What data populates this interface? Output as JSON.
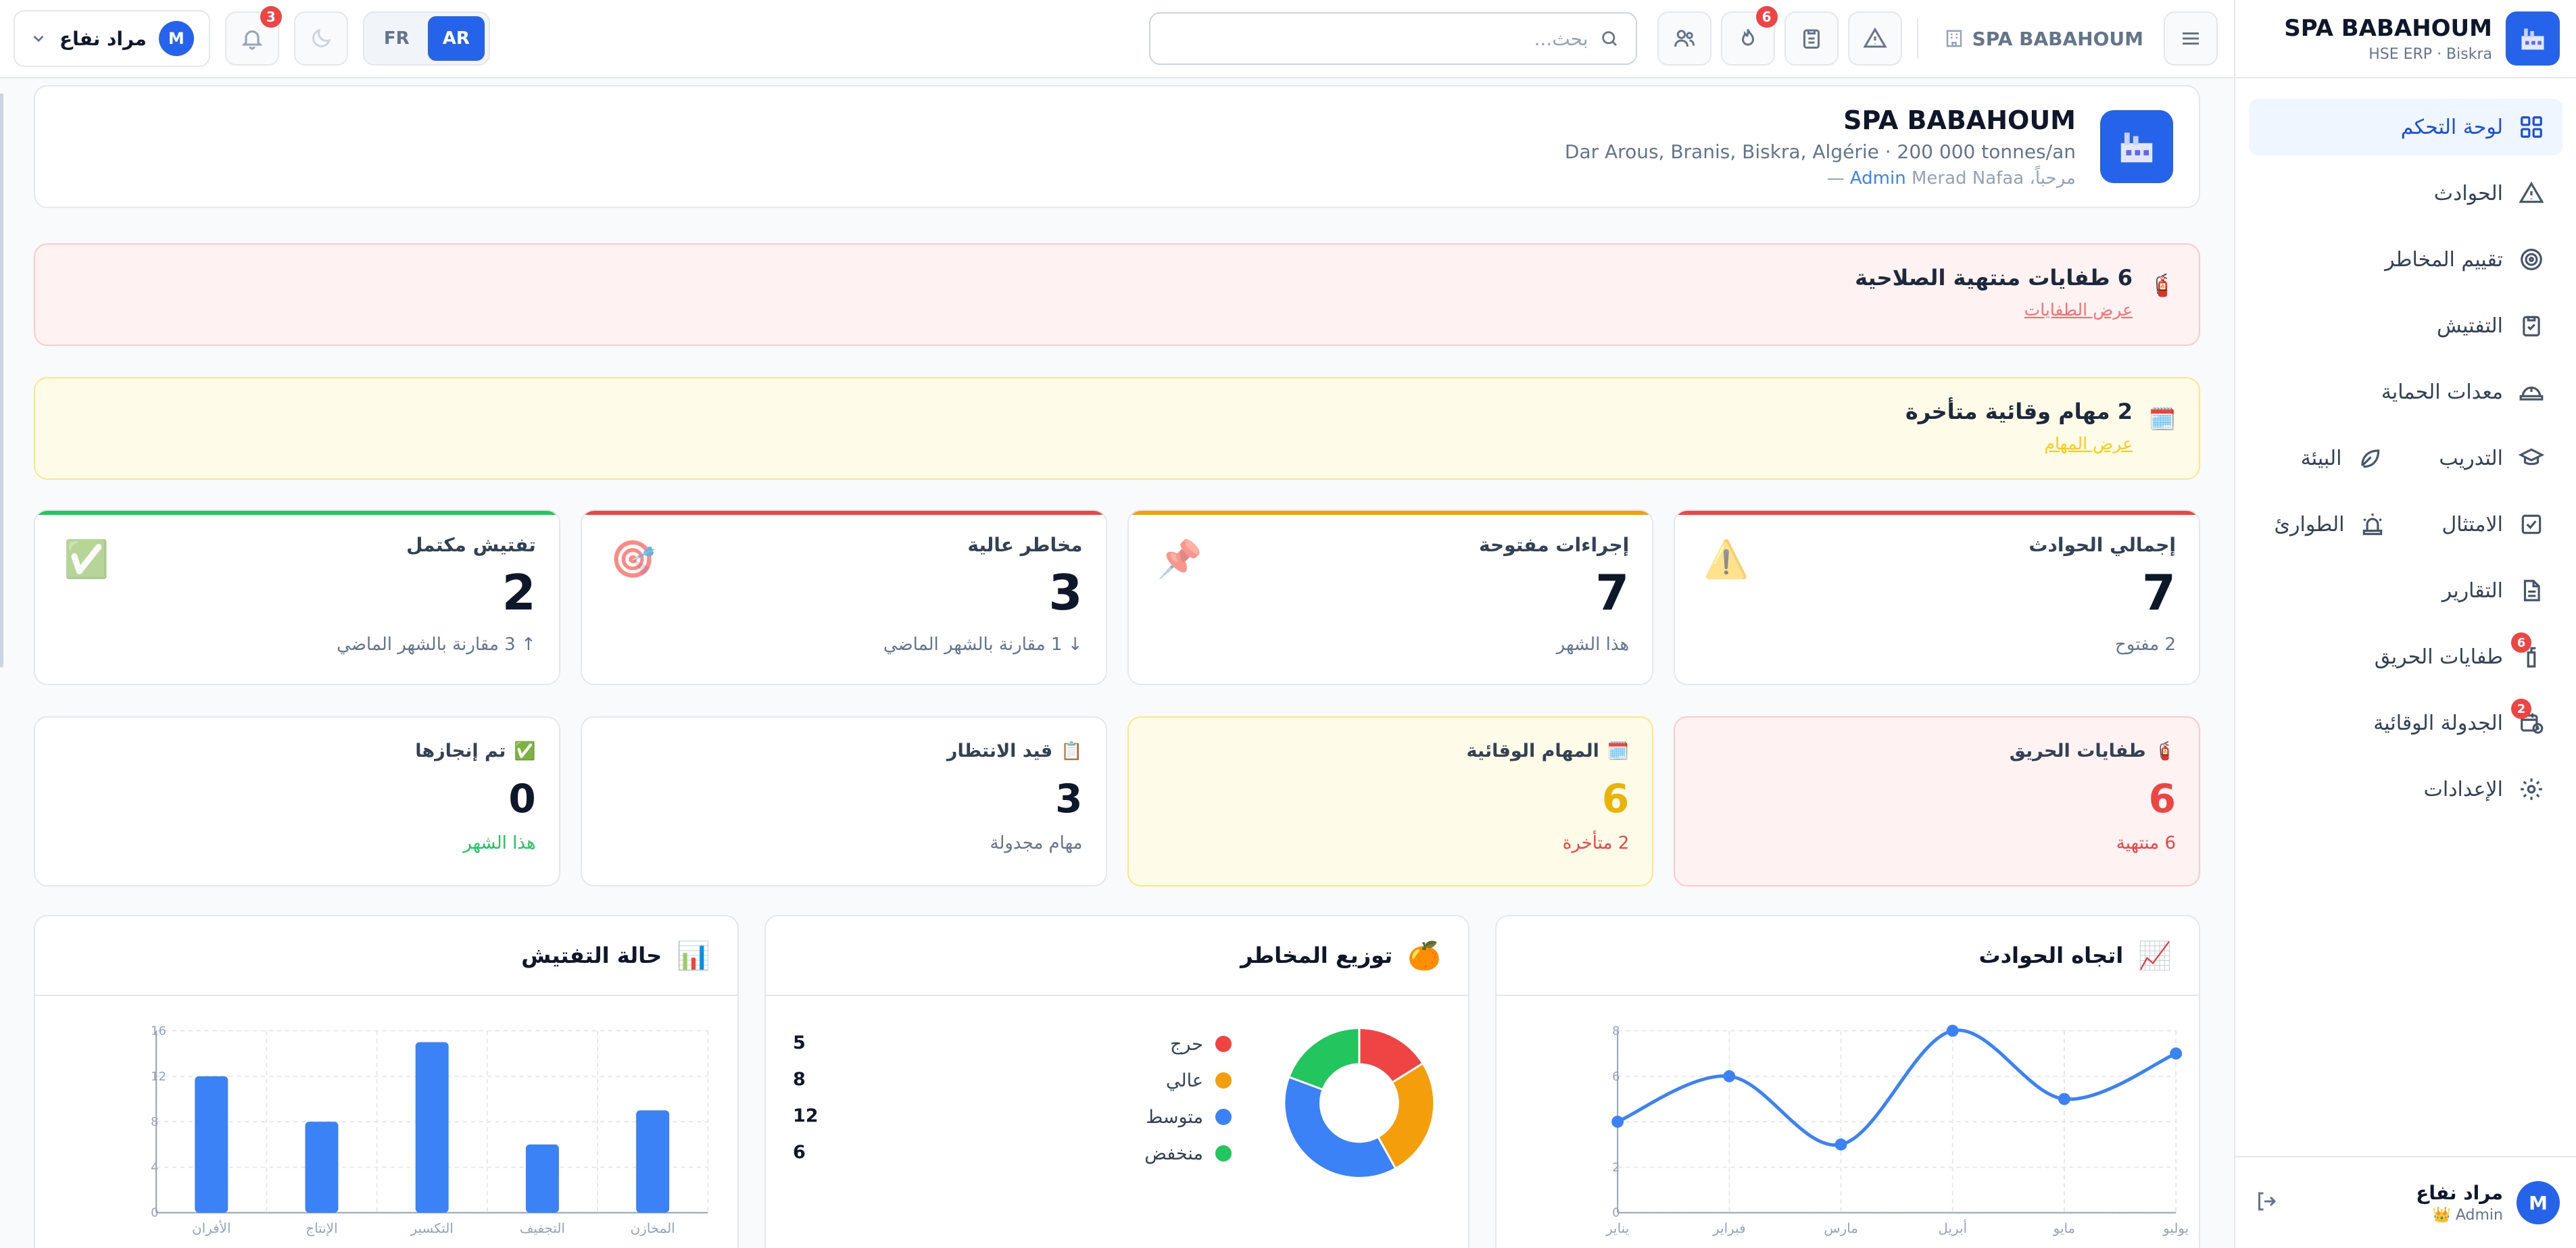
{
  "sidebar": {
    "brand_title": "SPA BABAHOUM",
    "brand_sub": "HSE ERP · Biskra",
    "items": [
      {
        "label": "لوحة التحكم",
        "icon": "dashboard-icon"
      },
      {
        "label": "الحوادث",
        "icon": "warning-icon"
      },
      {
        "label": "تقييم المخاطر",
        "icon": "target-icon"
      },
      {
        "label": "التفتيش",
        "icon": "clipboard-check-icon"
      },
      {
        "label": "معدات الحماية",
        "icon": "helmet-icon"
      },
      {
        "label": "التدريب",
        "icon": "graduation-cap-icon"
      },
      {
        "label": "البيئة",
        "icon": "leaf-icon"
      },
      {
        "label": "الامتثال",
        "icon": "check-square-icon"
      },
      {
        "label": "الطوارئ",
        "icon": "siren-icon"
      },
      {
        "label": "التقارير",
        "icon": "file-text-icon"
      },
      {
        "label": "طفايات الحريق",
        "icon": "extinguisher-icon",
        "badge": "6"
      },
      {
        "label": "الجدولة الوقائية",
        "icon": "calendar-clock-icon",
        "badge": "2"
      },
      {
        "label": "الإعدادات",
        "icon": "gear-icon"
      }
    ],
    "user_name": "مراد نفاع",
    "user_role": "Admin 👑",
    "avatar_letter": "M"
  },
  "topbar": {
    "company": "SPA BABAHOUM",
    "search_placeholder": "بحث...",
    "fire_badge": "6",
    "notif_badge": "3",
    "lang_ar": "AR",
    "lang_fr": "FR",
    "user_name": "مراد نفاع",
    "avatar_letter": "M"
  },
  "company_card": {
    "name": "SPA BABAHOUM",
    "address": "Dar Arous, Branis, Biskra, Algérie · 200 000 tonnes/an",
    "welcome_prefix": "مرحباً،",
    "welcome_name": "Merad Nafaa —",
    "welcome_role": "Admin"
  },
  "alerts": {
    "expired": {
      "icon": "🧯",
      "title": "6 طفايات منتهية الصلاحية",
      "link": "عرض الطفايات"
    },
    "overdue": {
      "icon": "🗓️",
      "title": "2 مهام وقائية متأخرة",
      "link": "عرض المهام"
    }
  },
  "stats": [
    {
      "label": "إجمالي الحوادث",
      "value": "7",
      "sub": "2 مفتوح",
      "emoji": "⚠️",
      "color": "#ef4444"
    },
    {
      "label": "إجراءات مفتوحة",
      "value": "7",
      "sub": "هذا الشهر",
      "emoji": "📌",
      "color": "#f59e0b"
    },
    {
      "label": "مخاطر عالية",
      "value": "3",
      "sub": "↓ 1 مقارنة بالشهر الماضي",
      "emoji": "🎯",
      "color": "#ef4444"
    },
    {
      "label": "تفتيش مكتمل",
      "value": "2",
      "sub": "↑ 3 مقارنة بالشهر الماضي",
      "emoji": "✅",
      "color": "#22c55e"
    }
  ],
  "stats2": [
    {
      "label": "طفايات الحريق",
      "emoji": "🧯",
      "value": "6",
      "sub": "6 منتهية"
    },
    {
      "label": "المهام الوقائية",
      "emoji": "🗓️",
      "value": "6",
      "sub": "2 متأخرة"
    },
    {
      "label": "قيد الانتظار",
      "emoji": "📋",
      "value": "3",
      "sub": "مهام مجدولة"
    },
    {
      "label": "تم إنجازها",
      "emoji": "✅",
      "value": "0",
      "sub": "هذا الشهر"
    }
  ],
  "charts": {
    "trend": {
      "title": "اتجاه الحوادث",
      "emoji": "📈"
    },
    "risks": {
      "title": "توزيع المخاطر",
      "emoji": "🍊"
    },
    "inspection": {
      "title": "حالة التفتيش",
      "emoji": "📊"
    }
  },
  "chart_data": [
    {
      "type": "line",
      "title": "اتجاه الحوادث",
      "categories": [
        "يناير",
        "فبراير",
        "مارس",
        "أبريل",
        "مايو",
        "يوليو"
      ],
      "values": [
        4,
        6,
        3,
        8,
        5,
        7
      ],
      "ylim": [
        0,
        8
      ],
      "yticks": [
        0,
        2,
        4,
        6,
        8
      ],
      "color": "#3b82f6",
      "grid": true
    },
    {
      "type": "pie",
      "title": "توزيع المخاطر",
      "categories": [
        "حرج",
        "عالي",
        "متوسط",
        "منخفض"
      ],
      "values": [
        5,
        8,
        12,
        6
      ],
      "colors": [
        "#ef4444",
        "#f59e0b",
        "#3b82f6",
        "#22c55e"
      ]
    },
    {
      "type": "bar",
      "title": "حالة التفتيش",
      "categories": [
        "الأفران",
        "الإنتاج",
        "التكسير",
        "التجفيف",
        "المخازن"
      ],
      "values": [
        12,
        8,
        15,
        6,
        9
      ],
      "ylim": [
        0,
        16
      ],
      "yticks": [
        0,
        4,
        8,
        12,
        16
      ],
      "color": "#3b82f6",
      "grid": true
    }
  ]
}
